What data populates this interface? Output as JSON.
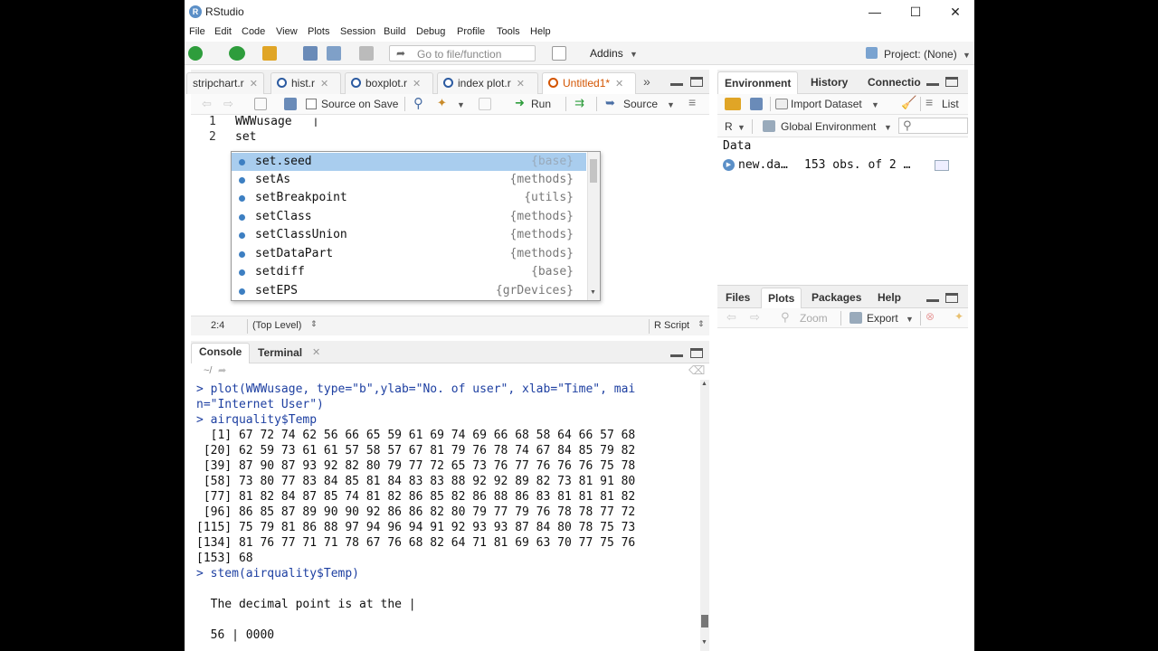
{
  "window": {
    "title": "RStudio",
    "logo": "R",
    "minimize": "—",
    "maximize": "☐",
    "close": "✕"
  },
  "menu": [
    "File",
    "Edit",
    "Code",
    "View",
    "Plots",
    "Session",
    "Build",
    "Debug",
    "Profile",
    "Tools",
    "Help"
  ],
  "toolbar": {
    "goto_placeholder": "Go to file/function",
    "addins_label": "Addins",
    "project_label": "Project: (None)"
  },
  "editor": {
    "tabs": [
      {
        "label": "stripchart.r",
        "active": false
      },
      {
        "label": "hist.r",
        "active": false
      },
      {
        "label": "boxplot.r",
        "active": false
      },
      {
        "label": "index plot.r",
        "active": false
      },
      {
        "label": "Untitled1*",
        "active": true
      }
    ],
    "source_on_save": "Source on Save",
    "run_label": "Run",
    "source_label": "Source",
    "lines": [
      {
        "num": "1",
        "text": "WWWusage"
      },
      {
        "num": "2",
        "text": "set"
      }
    ],
    "status": {
      "position": "2:4",
      "scope": "(Top Level)",
      "filetype": "R Script"
    }
  },
  "autocomplete": [
    {
      "name": "set.seed",
      "pkg": "{base}",
      "selected": true
    },
    {
      "name": "setAs",
      "pkg": "{methods}",
      "selected": false
    },
    {
      "name": "setBreakpoint",
      "pkg": "{utils}",
      "selected": false
    },
    {
      "name": "setClass",
      "pkg": "{methods}",
      "selected": false
    },
    {
      "name": "setClassUnion",
      "pkg": "{methods}",
      "selected": false
    },
    {
      "name": "setDataPart",
      "pkg": "{methods}",
      "selected": false
    },
    {
      "name": "setdiff",
      "pkg": "{base}",
      "selected": false
    },
    {
      "name": "setEPS",
      "pkg": "{grDevices}",
      "selected": false
    }
  ],
  "console": {
    "tabs": [
      "Console",
      "Terminal"
    ],
    "path": "~/",
    "lines": [
      {
        "text": "> plot(WWWusage, type=\"b\",ylab=\"No. of user\", xlab=\"Time\", mai",
        "cmd": true
      },
      {
        "text": "n=\"Internet User\")",
        "cmd": true
      },
      {
        "text": "> airquality$Temp",
        "cmd": true
      },
      {
        "text": "  [1] 67 72 74 62 56 66 65 59 61 69 74 69 66 68 58 64 66 57 68",
        "cmd": false
      },
      {
        "text": " [20] 62 59 73 61 61 57 58 57 67 81 79 76 78 74 67 84 85 79 82",
        "cmd": false
      },
      {
        "text": " [39] 87 90 87 93 92 82 80 79 77 72 65 73 76 77 76 76 76 75 78",
        "cmd": false
      },
      {
        "text": " [58] 73 80 77 83 84 85 81 84 83 83 88 92 92 89 82 73 81 91 80",
        "cmd": false
      },
      {
        "text": " [77] 81 82 84 87 85 74 81 82 86 85 82 86 88 86 83 81 81 81 82",
        "cmd": false
      },
      {
        "text": " [96] 86 85 87 89 90 90 92 86 86 82 80 79 77 79 76 78 78 77 72",
        "cmd": false
      },
      {
        "text": "[115] 75 79 81 86 88 97 94 96 94 91 92 93 93 87 84 80 78 75 73",
        "cmd": false
      },
      {
        "text": "[134] 81 76 77 71 71 78 67 76 68 82 64 71 81 69 63 70 77 75 76",
        "cmd": false
      },
      {
        "text": "[153] 68",
        "cmd": false
      },
      {
        "text": "> stem(airquality$Temp)",
        "cmd": true
      },
      {
        "text": "",
        "cmd": false
      },
      {
        "text": "  The decimal point is at the |",
        "cmd": false
      },
      {
        "text": "",
        "cmd": false
      },
      {
        "text": "  56 | 0000",
        "cmd": false
      }
    ]
  },
  "environment": {
    "tabs": [
      "Environment",
      "History",
      "Connectio"
    ],
    "import_label": "Import Dataset",
    "list_label": "List",
    "lang": "R",
    "scope": "Global Environment",
    "section": "Data",
    "items": [
      {
        "name": "new.da…",
        "desc": "153 obs. of 2 …"
      }
    ]
  },
  "files": {
    "tabs": [
      "Files",
      "Plots",
      "Packages",
      "Help"
    ],
    "zoom_label": "Zoom",
    "export_label": "Export"
  }
}
